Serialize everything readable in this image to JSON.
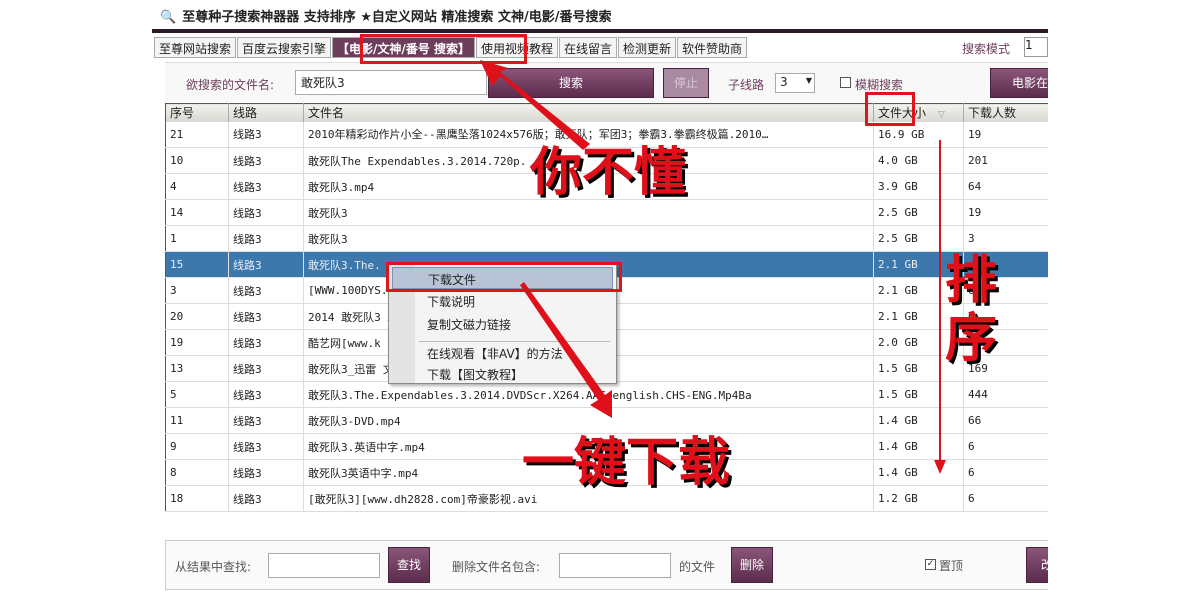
{
  "window": {
    "title": "至尊种子搜索神器器 支持排序 ★自定义网站 精准搜索   文神/电影/番号搜索"
  },
  "tabs": [
    "至尊网站搜索",
    "百度云搜索引擎",
    "【电影/文神/番号  搜索】",
    "使用视频教程",
    "在线留言",
    "检测更新",
    "软件赞助商"
  ],
  "search_mode": {
    "label": "搜索模式",
    "value": "1"
  },
  "search": {
    "label": "欲搜索的文件名:",
    "value": "敢死队3",
    "search_btn": "搜索",
    "stop_btn": "停止",
    "subline_label": "子线路",
    "subline_value": "3",
    "fuzzy_label": "模糊搜索",
    "movie_btn": "电影在"
  },
  "table": {
    "headers": [
      "序号",
      "线路",
      "文件名",
      "文件大小",
      "下载人数"
    ],
    "rows": [
      [
        "21",
        "线路3",
        "2010年精彩动作片小全--黑鹰坠落1024x576版；敢死队；军团3；拳霸3.拳霸终极篇.2010…",
        "16.9 GB",
        "19"
      ],
      [
        "10",
        "线路3",
        "敢死队The Expendables.3.2014.720p.",
        "4.0 GB",
        "201"
      ],
      [
        "4",
        "线路3",
        "敢死队3.mp4",
        "3.9 GB",
        "64"
      ],
      [
        "14",
        "线路3",
        "敢死队3",
        "2.5 GB",
        "19"
      ],
      [
        "1",
        "线路3",
        "敢死队3",
        "2.5 GB",
        "3"
      ],
      [
        "15",
        "线路3",
        "敢死队3.The.",
        "2.1 GB",
        ""
      ],
      [
        "3",
        "线路3",
        "[WWW.100DYS.                                   ) 720p DVDScr [G2G]-muxed.mkv",
        "2.1 GB",
        "6"
      ],
      [
        "20",
        "线路3",
        "2014 敢死队3                                   XED.CLEAN.XviD-XVCTY.2.05GB",
        "2.1 GB",
        "6"
      ],
      [
        "19",
        "线路3",
        "酷艺网[www.k                                   014.HD480p.x264.AAC 英语中字",
        "2.0 GB",
        ""
      ],
      [
        "13",
        "线路3",
        "敢死队3_迅雷                                   文字幕.torrent.wmv",
        "1.5 GB",
        "169"
      ],
      [
        "5",
        "线路3",
        "敢死队3.The.Expendables.3.2014.DVDScr.X264.AAC.english.CHS-ENG.Mp4Ba",
        "1.5 GB",
        "444"
      ],
      [
        "11",
        "线路3",
        "敢死队3-DVD.mp4",
        "1.4 GB",
        "66"
      ],
      [
        "9",
        "线路3",
        "敢死队3.英语中字.mp4",
        "1.4 GB",
        "6"
      ],
      [
        "8",
        "线路3",
        "敢死队3英语中字.mp4",
        "1.4 GB",
        "6"
      ],
      [
        "18",
        "线路3",
        "[敢死队3][www.dh2828.com]帝豪影视.avi",
        "1.2 GB",
        "6"
      ]
    ]
  },
  "context_menu": [
    "下载文件",
    "下载说明",
    "复制文磁力链接",
    "在线观看【非AV】的方法",
    "下载【图文教程】"
  ],
  "bottom": {
    "find_label": "从结果中查找:",
    "find_btn": "查找",
    "delete_label": "删除文件名包含:",
    "delete_suffix": "的文件",
    "delete_btn": "删除",
    "pin_label": "置顶",
    "more_btn": "改"
  },
  "annotations": {
    "not_understand": "你不懂",
    "sort": "排序",
    "one_click": "一键下载"
  },
  "colors": {
    "accent": "#6d3e5c",
    "selection": "#3d78ad",
    "annotation": "#e0101a"
  }
}
